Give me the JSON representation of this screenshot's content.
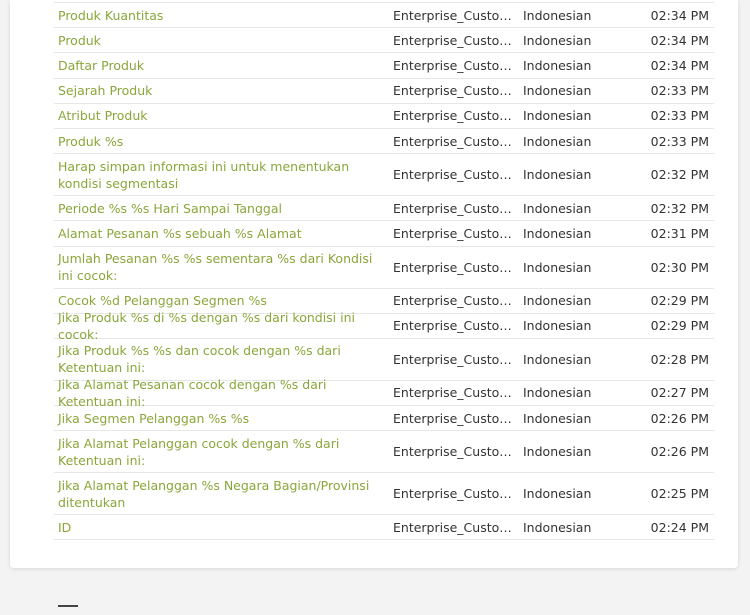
{
  "rows": [
    {
      "text": "Produk Kuantitas",
      "source": "Enterprise_Customer",
      "language": "Indonesian",
      "time": "02:34 PM",
      "lines": 1
    },
    {
      "text": "Produk",
      "source": "Enterprise_Customer",
      "language": "Indonesian",
      "time": "02:34 PM",
      "lines": 1
    },
    {
      "text": "Daftar Produk",
      "source": "Enterprise_Customer",
      "language": "Indonesian",
      "time": "02:34 PM",
      "lines": 1
    },
    {
      "text": "Sejarah Produk",
      "source": "Enterprise_Customer",
      "language": "Indonesian",
      "time": "02:33 PM",
      "lines": 1
    },
    {
      "text": "Atribut Produk",
      "source": "Enterprise_Customer",
      "language": "Indonesian",
      "time": "02:33 PM",
      "lines": 1
    },
    {
      "text": "Produk %s",
      "source": "Enterprise_Customer",
      "language": "Indonesian",
      "time": "02:33 PM",
      "lines": 1
    },
    {
      "text": "Harap simpan informasi ini untuk menentukan kondisi segmentasi",
      "source": "Enterprise_Customer",
      "language": "Indonesian",
      "time": "02:32 PM",
      "lines": 2
    },
    {
      "text": "Periode %s %s Hari Sampai Tanggal",
      "source": "Enterprise_Customer",
      "language": "Indonesian",
      "time": "02:32 PM",
      "lines": 1
    },
    {
      "text": "Alamat Pesanan %s sebuah %s Alamat",
      "source": "Enterprise_Customer",
      "language": "Indonesian",
      "time": "02:31 PM",
      "lines": 1
    },
    {
      "text": "Jumlah Pesanan %s %s sementara %s dari Kondisi ini cocok:",
      "source": "Enterprise_Customer",
      "language": "Indonesian",
      "time": "02:30 PM",
      "lines": 2
    },
    {
      "text": "Cocok %d Pelanggan Segmen %s",
      "source": "Enterprise_Customer",
      "language": "Indonesian",
      "time": "02:29 PM",
      "lines": 1
    },
    {
      "text": "Jika Produk %s di %s dengan %s dari kondisi ini cocok:",
      "source": "Enterprise_Customer",
      "language": "Indonesian",
      "time": "02:29 PM",
      "lines": 1
    },
    {
      "text": "Jika Produk %s %s dan cocok dengan %s dari Ketentuan ini:",
      "source": "Enterprise_Customer",
      "language": "Indonesian",
      "time": "02:28 PM",
      "lines": 2
    },
    {
      "text": "Jika Alamat Pesanan cocok dengan %s dari Ketentuan ini:",
      "source": "Enterprise_Customer",
      "language": "Indonesian",
      "time": "02:27 PM",
      "lines": 1
    },
    {
      "text": "Jika Segmen Pelanggan %s %s",
      "source": "Enterprise_Customer",
      "language": "Indonesian",
      "time": "02:26 PM",
      "lines": 1
    },
    {
      "text": "Jika Alamat Pelanggan cocok dengan %s dari Ketentuan ini:",
      "source": "Enterprise_Customer",
      "language": "Indonesian",
      "time": "02:26 PM",
      "lines": 2
    },
    {
      "text": "Jika Alamat Pelanggan %s Negara Bagian/Provinsi ditentukan",
      "source": "Enterprise_Customer",
      "language": "Indonesian",
      "time": "02:25 PM",
      "lines": 2
    },
    {
      "text": "ID",
      "source": "Enterprise_Customer",
      "language": "Indonesian",
      "time": "02:24 PM",
      "lines": 1
    }
  ]
}
